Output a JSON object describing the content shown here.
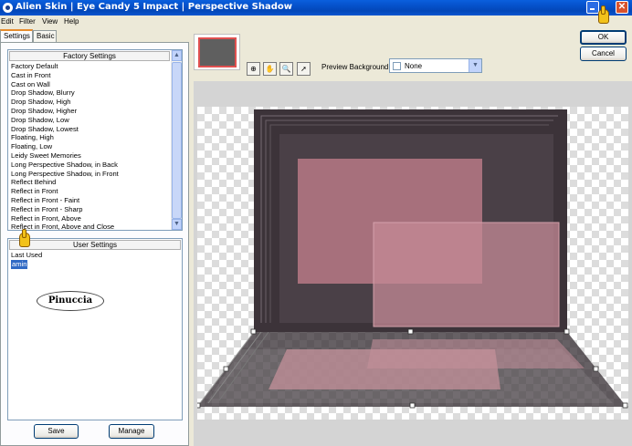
{
  "window": {
    "title": "Alien Skin | Eye Candy 5 Impact | Perspective Shadow",
    "close_glyph": "✕"
  },
  "menu": [
    "Edit",
    "Filter",
    "View",
    "Help"
  ],
  "tabs": [
    "Settings",
    "Basic"
  ],
  "factory": {
    "header": "Factory Settings",
    "items": [
      "Factory Default",
      "Cast in Front",
      "Cast on Wall",
      "Drop Shadow, Blurry",
      "Drop Shadow, High",
      "Drop Shadow, Higher",
      "Drop Shadow, Low",
      "Drop Shadow, Lowest",
      "Floating, High",
      "Floating, Low",
      "Leidy Sweet Memories",
      "Long Perspective Shadow, in Back",
      "Long Perspective Shadow, in Front",
      "Reflect Behind",
      "Reflect in Front",
      "Reflect in Front - Faint",
      "Reflect in Front - Sharp",
      "Reflect in Front, Above",
      "Reflect in Front, Above and Close"
    ]
  },
  "user_settings": {
    "header": "User Settings",
    "items": [
      "Last Used"
    ],
    "selected": "amin"
  },
  "logo_text": "Pinuccia",
  "buttons": {
    "save": "Save",
    "manage": "Manage",
    "ok": "OK",
    "cancel": "Cancel"
  },
  "preview": {
    "label": "Preview Background:",
    "value": "None"
  },
  "icons": {
    "arrow_up": "▲",
    "arrow_down": "▼",
    "tools": [
      "navigate-icon",
      "hand-icon",
      "zoom-icon",
      "pointer-icon"
    ],
    "tool_glyphs": [
      "⊕",
      "✋",
      "🔍",
      "➚"
    ]
  },
  "colors": {
    "title_bar": "#0550c9",
    "selection": "#316ac5",
    "artwork_dark": "#3c3339",
    "artwork_pink": "#a66f7b"
  }
}
